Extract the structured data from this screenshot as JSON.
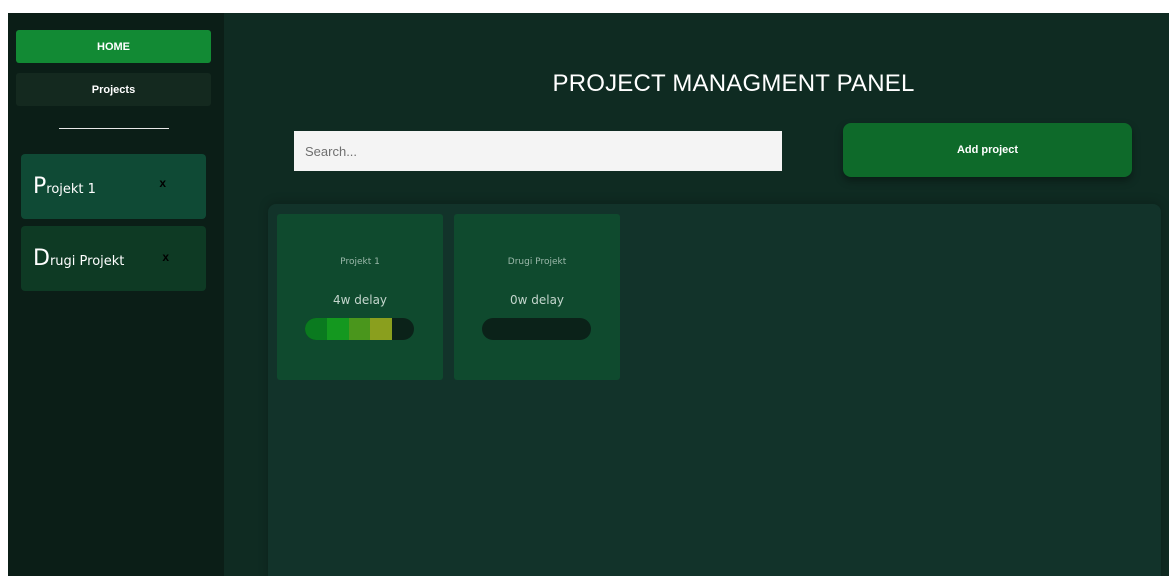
{
  "sidebar": {
    "home_label": "HOME",
    "projects_label": "Projects",
    "items": [
      {
        "first_letter": "P",
        "rest": "rojekt 1",
        "close": "x"
      },
      {
        "first_letter": "D",
        "rest": "rugi Projekt",
        "close": "x"
      }
    ]
  },
  "header": {
    "title": "PROJECT MANAGMENT PANEL"
  },
  "search": {
    "placeholder": "Search...",
    "value": ""
  },
  "add_button": {
    "label": "Add project"
  },
  "cards": [
    {
      "name": "Projekt 1",
      "delay": "4w delay",
      "progress_segments": 4,
      "total_segments": 5,
      "segment_colors": [
        "#0a7a1f",
        "#14981f",
        "#4a961c",
        "#8a9f1e"
      ]
    },
    {
      "name": "Drugi Projekt",
      "delay": "0w delay",
      "progress_segments": 0,
      "total_segments": 5,
      "segment_colors": []
    }
  ],
  "colors": {
    "accent": "#128a34",
    "sidebar_bg": "#0b1e17",
    "main_bg": "#0f2b22",
    "card_bg": "#0f4a2e"
  }
}
